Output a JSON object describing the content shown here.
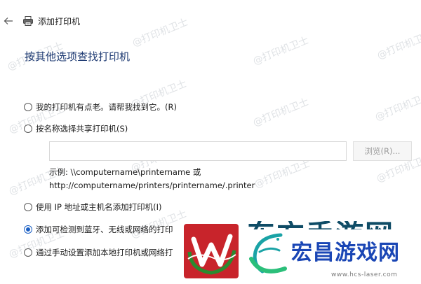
{
  "header": {
    "title": "添加打印机"
  },
  "page": {
    "heading": "按其他选项查找打印机"
  },
  "options": [
    {
      "label": "我的打印机有点老。请帮我找到它。(R)",
      "checked": false
    },
    {
      "label": "按名称选择共享打印机(S)",
      "checked": false
    },
    {
      "label": "使用 IP 地址或主机名添加打印机(I)",
      "checked": false
    },
    {
      "label": "添加可检测到蓝牙、无线或网络的打印",
      "checked": true
    },
    {
      "label": "通过手动设置添加本地打印机或网络打",
      "checked": false
    }
  ],
  "share": {
    "input_value": "",
    "browse_label": "浏览(R)...",
    "example_line1": "示例: \\\\computername\\printername 或",
    "example_line2": "http://computername/printers/printername/.printer"
  },
  "watermark": {
    "text": "@打印机卫士"
  },
  "advert": {
    "ghost_text": "东方手游网",
    "brand": "宏昌游戏网",
    "url": "www.hcs-laser.com"
  },
  "colors": {
    "heading": "#1f3b73",
    "radio_selected": "#1a5fc4",
    "watermark": "#cfd3d8",
    "ad_brand": "#1a46b5",
    "ad_logo_red": "#c8242b"
  },
  "icons": {
    "back": "back-arrow-icon",
    "printer": "printer-icon",
    "ad_logo": "logo-w-icon",
    "ad_fish": "fish-logo-icon"
  }
}
